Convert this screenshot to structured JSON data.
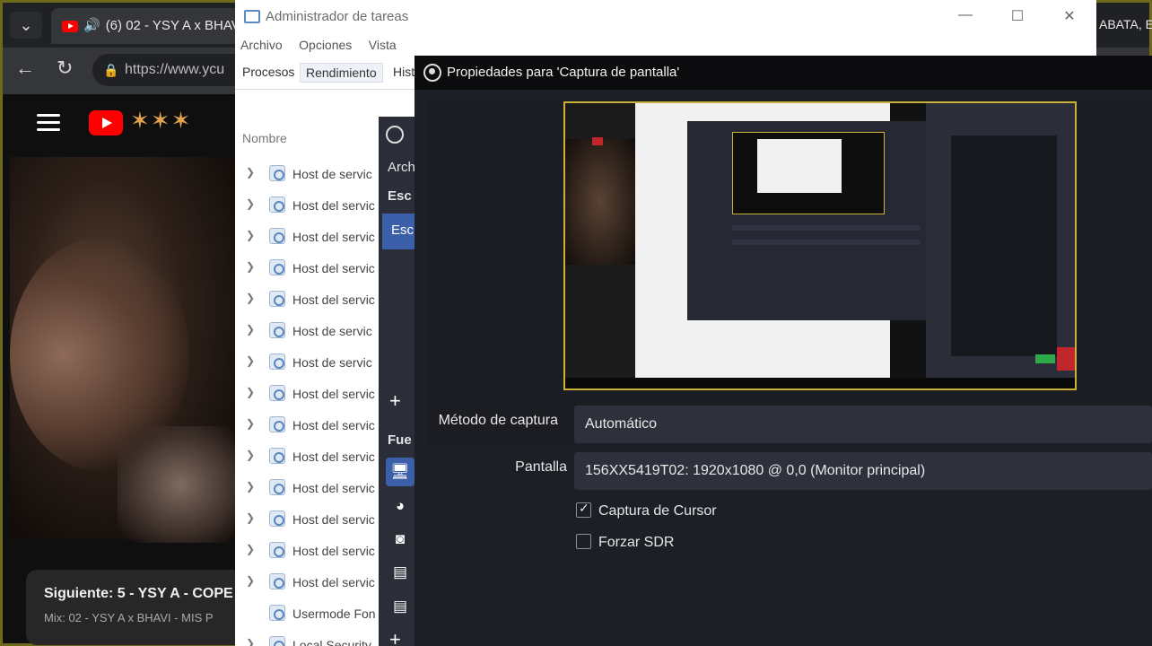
{
  "browser": {
    "tab_title": "(6) 02 - YSY A x BHAVI",
    "right_text": "ABATA, El",
    "url": "https://www.ycu",
    "next": {
      "title": "Siguiente: 5 - YSY A - COPE",
      "subtitle": "Mix: 02 - YSY A x BHAVI - MIS P"
    }
  },
  "taskmgr": {
    "title": "Administrador de tareas",
    "menu": [
      "Archivo",
      "Opciones",
      "Vista"
    ],
    "tabs": [
      "Procesos",
      "Rendimiento",
      "Hist"
    ],
    "column_name": "Nombre",
    "rows": [
      "Host de servic",
      "Host del servic",
      "Host del servic",
      "Host del servic",
      "Host del servic",
      "Host de servic",
      "Host de servic",
      "Host del servic",
      "Host del servic",
      "Host del servic",
      "Host del servic",
      "Host del servic",
      "Host del servic",
      "Host del servic",
      "Usermode Fon",
      "Local Security"
    ]
  },
  "obs": {
    "menu_arch": "Arch",
    "scenes_header": "Esc",
    "scene_selected": "Esc",
    "sources_header": "Fue"
  },
  "dialog": {
    "title": "Propiedades para 'Captura de pantalla'",
    "capture_method_label": "Método de captura",
    "capture_method_value": "Automático",
    "display_label": "Pantalla",
    "display_value": "156XX5419T02: 1920x1080 @ 0,0 (Monitor principal)",
    "capture_cursor_label": "Captura de Cursor",
    "capture_cursor_checked": true,
    "force_sdr_label": "Forzar SDR",
    "force_sdr_checked": false
  }
}
